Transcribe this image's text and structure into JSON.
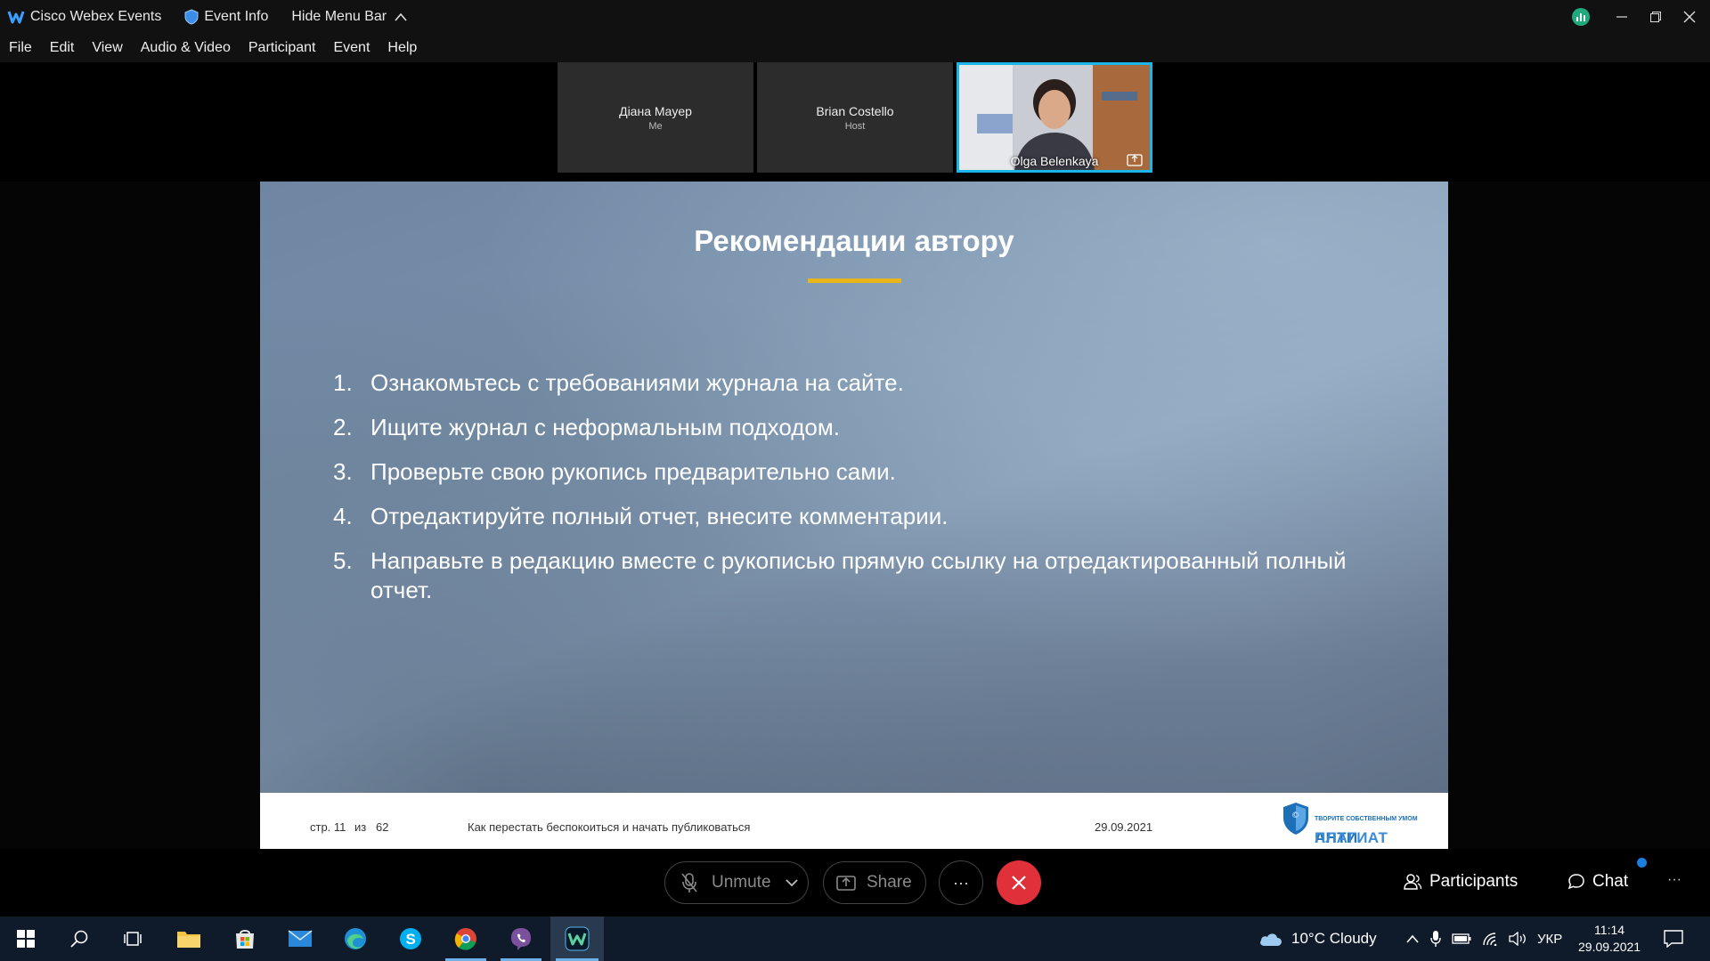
{
  "titlebar": {
    "app_name": "Cisco Webex Events",
    "event_info": "Event Info",
    "hide_menu": "Hide Menu Bar"
  },
  "menu": [
    "File",
    "Edit",
    "View",
    "Audio & Video",
    "Participant",
    "Event",
    "Help"
  ],
  "participants_strip": [
    {
      "name": "Діана Mayep",
      "role": "Me"
    },
    {
      "name": "Brian Costello",
      "role": "Host"
    },
    {
      "name": "Olga Belenkaya",
      "role": ""
    }
  ],
  "slide": {
    "title": "Рекомендации автору",
    "items": [
      {
        "num": "1.",
        "text": "Ознакомьтесь с требованиями журнала на сайте."
      },
      {
        "num": "2.",
        "text": "Ищите журнал с неформальным подходом."
      },
      {
        "num": "3.",
        "text": "Проверьте свою рукопись предварительно сами."
      },
      {
        "num": "4.",
        "text": "Отредактируйте полный отчет, внесите комментарии."
      },
      {
        "num": "5.",
        "text": "Направьте в редакцию вместе с рукописью  прямую ссылку на отредактированный полный отчет."
      }
    ],
    "footer": {
      "page_label": "стр. 11",
      "of_label": "из",
      "total": "62",
      "subtitle": "Как перестать беспокоиться и начать публиковаться",
      "date": "29.09.2021",
      "logo_word_a": "АНТИ",
      "logo_word_b": "ПЛАГИАТ",
      "logo_tagline": "ТВОРИТЕ СОБСТВЕННЫМ УМОМ"
    }
  },
  "controls": {
    "unmute": "Unmute",
    "share": "Share",
    "more": "···",
    "participants": "Participants",
    "chat": "Chat",
    "overflow": "···"
  },
  "taskbar": {
    "weather": "10°C  Cloudy",
    "lang": "УКР",
    "time": "11:14",
    "date": "29.09.2021"
  },
  "colors": {
    "accent_blue": "#1cb5e8",
    "end_red": "#e0303a",
    "slide_underline": "#e8b617",
    "chat_dot": "#1a7fe0"
  }
}
